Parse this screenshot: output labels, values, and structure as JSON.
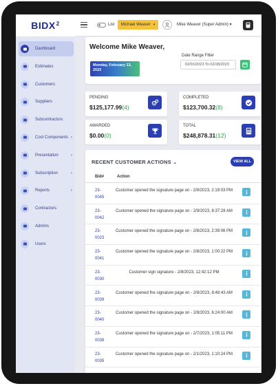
{
  "app": {
    "logo_text": "BIDX",
    "logo_sup": "2"
  },
  "sidebar": {
    "items": [
      {
        "label": "Dashboard",
        "icon": "dashboard-icon",
        "active": true,
        "has_arrow": false
      },
      {
        "label": "Estimates",
        "icon": "estimates-icon",
        "active": false,
        "has_arrow": false
      },
      {
        "label": "Customers",
        "icon": "customers-icon",
        "active": false,
        "has_arrow": false
      },
      {
        "label": "Suppliers",
        "icon": "suppliers-icon",
        "active": false,
        "has_arrow": false
      },
      {
        "label": "Subcontractors",
        "icon": "subcontractors-icon",
        "active": false,
        "has_arrow": false
      },
      {
        "label": "Cost Components",
        "icon": "cost-components-icon",
        "active": false,
        "has_arrow": true
      },
      {
        "label": "Presentation",
        "icon": "presentation-icon",
        "active": false,
        "has_arrow": true
      },
      {
        "label": "Subscription",
        "icon": "subscription-icon",
        "active": false,
        "has_arrow": true
      },
      {
        "label": "Reports",
        "icon": "reports-icon",
        "active": false,
        "has_arrow": true
      },
      {
        "label": "Contractors",
        "icon": "contractors-icon",
        "active": false,
        "has_arrow": false
      },
      {
        "label": "Admins",
        "icon": "admins-icon",
        "active": false,
        "has_arrow": false
      },
      {
        "label": "Users",
        "icon": "users-icon",
        "active": false,
        "has_arrow": false
      }
    ],
    "arrow_glyph": "›"
  },
  "topbar": {
    "list_label": "List",
    "user_select": "Michael Weaver",
    "user_select_caret": "▾",
    "user_name": "Mike Weaver (Super Admin)",
    "user_caret": "▾"
  },
  "welcome": {
    "title": "Welcome Mike Weaver,",
    "date_badge": "Monday, February 13, 2023",
    "range_label": "Date Range Filter",
    "range_value": "02/01/2023 To 02/28/2023"
  },
  "stats": [
    {
      "label": "PENDING",
      "value": "$125,177.99",
      "count": "(4)",
      "icon": "gears-icon"
    },
    {
      "label": "COMPLETED",
      "value": "$123,700.32",
      "count": "(8)",
      "icon": "checkmark-icon"
    },
    {
      "label": "AWARDED",
      "value": "$0.00",
      "count": "(0)",
      "icon": "trophy-icon"
    },
    {
      "label": "TOTAL",
      "value": "$248,878.31",
      "count": "(12)",
      "icon": "calculator-icon"
    }
  ],
  "actions": {
    "title": "RECENT CUSTOMER ACTIONS",
    "title_caret": "⌄",
    "view_all": "VIEW ALL",
    "columns": {
      "bid": "Bid#",
      "action": "Action"
    },
    "rows": [
      {
        "bid": "23-0045",
        "action": "Customer opened the signature page on - 2/9/2023, 2:19:03 PM"
      },
      {
        "bid": "23-0042",
        "action": "Customer opened the signature page on - 2/9/2023, 8:37:28 AM"
      },
      {
        "bid": "23-0023",
        "action": "Customer opened the signature page on - 2/8/2023, 2:39:06 PM"
      },
      {
        "bid": "23-0041",
        "action": "Customer opened the signature page on - 2/8/2023, 1:00:22 PM"
      },
      {
        "bid": "23-0030",
        "action": "Customer sign signature - 2/8/2023, 12:42:12 PM"
      },
      {
        "bid": "23-0039",
        "action": "Customer opened the signature page on - 2/8/2023, 8:48:43 AM"
      },
      {
        "bid": "23-0040",
        "action": "Customer opened the signature page on - 2/8/2023, 6:24:00 AM"
      },
      {
        "bid": "23-0038",
        "action": "Customer opened the signature page on - 2/7/2023, 1:05:11 PM"
      },
      {
        "bid": "23-0035",
        "action": "Customer opened the signature page on - 2/1/2023, 1:10:24 PM"
      }
    ]
  },
  "colors": {
    "primary": "#2c3eb3",
    "accent_yellow": "#f5c23c",
    "success": "#2fa44d",
    "info": "#56b8d9",
    "sidebar_bg": "#e2e6f4"
  }
}
